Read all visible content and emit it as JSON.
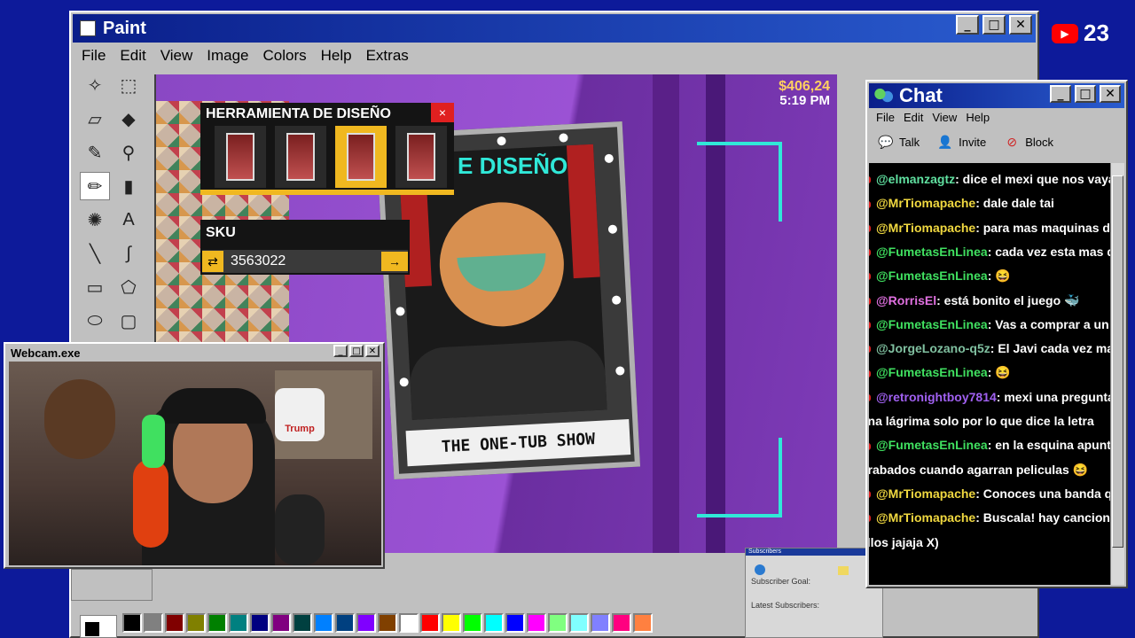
{
  "youtube": {
    "count": "23"
  },
  "paint": {
    "title": "Paint",
    "menu": [
      "File",
      "Edit",
      "View",
      "Image",
      "Colors",
      "Help",
      "Extras"
    ],
    "palette": [
      "#000000",
      "#808080",
      "#800000",
      "#808000",
      "#008000",
      "#008080",
      "#000080",
      "#800080",
      "#004040",
      "#0080ff",
      "#004080",
      "#8000ff",
      "#804000",
      "#ffffff",
      "#ff0000",
      "#ffff00",
      "#00ff00",
      "#00ffff",
      "#0000ff",
      "#ff00ff",
      "#80ff80",
      "#80ffff",
      "#8080ff",
      "#ff0080",
      "#ff8040"
    ]
  },
  "game": {
    "money": "$406,24",
    "time": "5:19 PM",
    "panel_title": "HERRAMIENTA DE DISEÑO",
    "panel_close": "×",
    "partial_title": "E DISEÑO",
    "sku_label": "SKU",
    "sku_value": "3563022",
    "sku_icon": "⇄",
    "sku_go": "→",
    "poster_caption": "THE ONE-TUB SHOW"
  },
  "webcam": {
    "title": "Webcam.exe",
    "box_label": "Trump"
  },
  "chat": {
    "title": "Chat",
    "menu": [
      "File",
      "Edit",
      "View",
      "Help"
    ],
    "tools": [
      "Talk",
      "Invite",
      "Block"
    ],
    "messages": [
      {
        "user": "@elmanzagtz",
        "text": ": dice el mexi que nos vayan"
      },
      {
        "user": "@MrTiomapache",
        "text": ": dale dale tai"
      },
      {
        "user": "@MrTiomapache",
        "text": ": para mas maquinas de ju"
      },
      {
        "user": "@FumetasEnLinea",
        "text": ": cada vez esta mas deco"
      },
      {
        "user": "@FumetasEnLinea",
        "text": ": 😆"
      },
      {
        "user": "@RorrisEl",
        "text": ": está bonito el juego 🐳"
      },
      {
        "user": "@FumetasEnLinea",
        "text": ": Vas a comprar a un seg"
      },
      {
        "user": "@JorgeLozano-q5z",
        "text": ": El Javi cada vez mas d"
      },
      {
        "user": "@FumetasEnLinea",
        "text": ": 😆"
      },
      {
        "user": "@retronightboy7814",
        "text": ": mexi una pregunta cu"
      },
      {
        "user": "",
        "text": "una lágrima solo por lo que dice la letra"
      },
      {
        "user": "@FumetasEnLinea",
        "text": ": en la esquina apuntand"
      },
      {
        "user": "",
        "text": "grabados cuando agarran peliculas 😆"
      },
      {
        "user": "@MrTiomapache",
        "text": ": Conoces una banda que s"
      },
      {
        "user": "@MrTiomapache",
        "text": ": Buscala! hay canciones c"
      },
      {
        "user": "",
        "text": "ellos jajaja X)"
      }
    ]
  },
  "subscribers": {
    "title": "Subscribers",
    "goal_label": "Subscriber Goal:",
    "latest_label": "Latest Subscribers:"
  }
}
